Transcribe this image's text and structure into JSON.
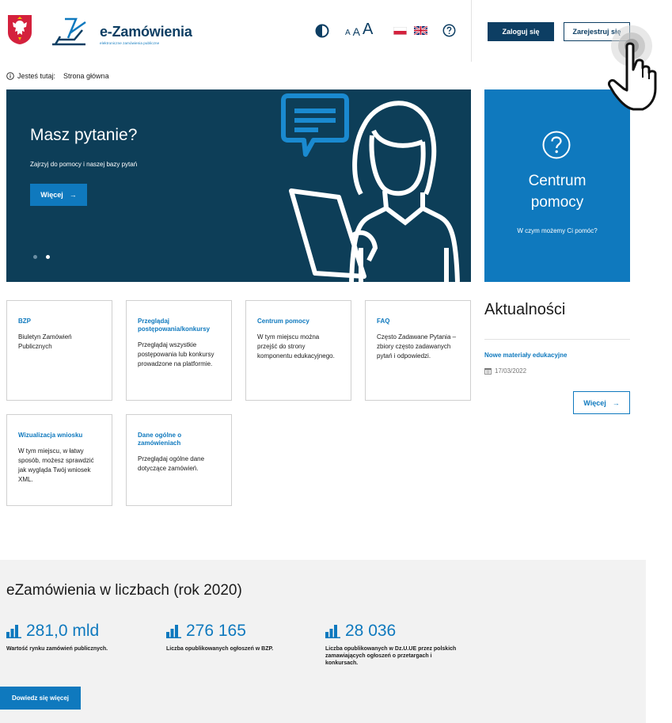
{
  "header": {
    "logo_title": "e-Zamówienia",
    "logo_subtitle": "elektroniczne zamówienia publiczne",
    "font_small": "A",
    "font_mid": "A",
    "font_large": "A",
    "login_label": "Zaloguj się",
    "register_label": "Zarejestruj się"
  },
  "breadcrumb": {
    "prefix": "Jesteś tutaj:",
    "current": "Strona główna"
  },
  "hero": {
    "title": "Masz pytanie?",
    "text": "Zajrzyj do pomocy i naszej bazy pytań",
    "button_label": "Więcej",
    "arrow": "→",
    "slides": 2,
    "active_slide": 2
  },
  "help_tile": {
    "title": "Centrum\npomocy",
    "subtitle": "W czym możemy Ci pomóc?"
  },
  "cards": [
    {
      "title": "BZP",
      "text": "Biuletyn Zamówień Publicznych"
    },
    {
      "title": "Przeglądaj postępowania/konkursy",
      "text": "Przeglądaj wszystkie postępowania lub konkursy prowadzone na platformie."
    },
    {
      "title": "Centrum pomocy",
      "text": "W tym miejscu można przejść do strony komponentu edukacyjnego."
    },
    {
      "title": "FAQ",
      "text": "Często Zadawane Pytania – zbiory często zadawanych pytań i odpowiedzi."
    },
    {
      "title": "Wizualizacja wniosku",
      "text": "W tym miejscu, w łatwy sposób, możesz sprawdzić jak wygląda Twój wniosek XML."
    },
    {
      "title": "Dane ogólne o zamówieniach",
      "text": "Przeglądaj ogólne dane dotyczące zamówień."
    }
  ],
  "news": {
    "heading": "Aktualności",
    "item_title": "Nowe materiały edukacyjne",
    "item_date": "17/03/2022",
    "button_label": "Więcej",
    "arrow": "→"
  },
  "stats": {
    "title": "eZamówienia w liczbach (rok 2020)",
    "items": [
      {
        "value": "281,0 mld",
        "desc": "Wartość rynku zamówień publicznych."
      },
      {
        "value": "276 165",
        "desc": "Liczba opublikowanych ogłoszeń w BZP."
      },
      {
        "value": "28 036",
        "desc": "Liczba opublikowanych w Dz.U.UE przez polskich zamawiających ogłoszeń o przetargach i konkursach."
      }
    ],
    "button_label": "Dowiedz się więcej"
  },
  "colors": {
    "navy": "#0d3e63",
    "hero_bg": "#0d3e58",
    "accent_blue": "#0f79be",
    "stats_bg": "#f2f2f2"
  },
  "icons": [
    "poland-emblem-icon",
    "e-zamowienia-logo-icon",
    "contrast-icon",
    "flag-pl-icon",
    "flag-gb-icon",
    "help-icon",
    "info-icon",
    "chat-bubble-icon",
    "calendar-icon",
    "bar-chart-icon",
    "hand-pointer-icon"
  ]
}
